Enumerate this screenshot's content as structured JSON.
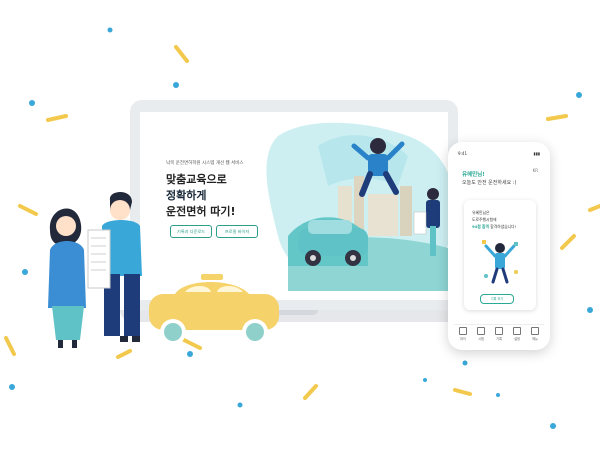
{
  "site": {
    "tagline": "낙목 운전면허학원 시스템 개선 웹 서비스",
    "headline_line1": "맞춤교육으로",
    "headline_line2": "정확하게",
    "headline_line3": "운전면허 따기!",
    "button_primary": "기록과 다운로드",
    "button_secondary": "프로필 바이저"
  },
  "phone": {
    "greeting": "유혜민님!",
    "subtitle": "오늘도 안전 운전하세요 :)",
    "language": "KR",
    "card_lines": [
      "유혜민님은",
      "도로주행시험에",
      "합격하셨습니다!"
    ],
    "card_highlight_1": "94점",
    "card_highlight_2": "합격",
    "card_button": "기록 보기",
    "nav": [
      "마이",
      "시험",
      "기록",
      "설정",
      "메뉴"
    ]
  },
  "colors": {
    "teal": "#2ba896",
    "light_teal": "#c5ecf0",
    "yellow": "#f6d26a",
    "navy": "#1f3c7a",
    "confetti_blue": "#3aa7d9",
    "confetti_yellow": "#f2c94c"
  }
}
